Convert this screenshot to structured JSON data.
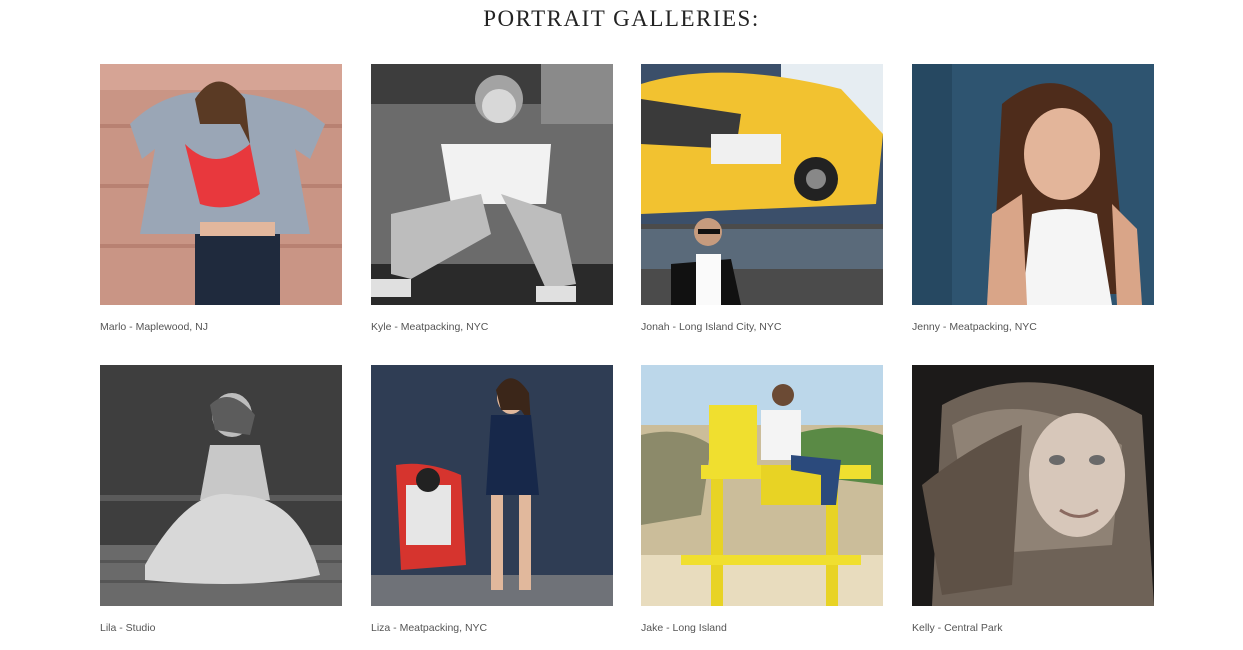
{
  "page": {
    "title": "PORTRAIT GALLERIES:"
  },
  "galleries": [
    {
      "caption": "Marlo - Maplewood, NJ"
    },
    {
      "caption": "Kyle - Meatpacking, NYC"
    },
    {
      "caption": "Jonah - Long Island City, NYC"
    },
    {
      "caption": "Jenny - Meatpacking, NYC"
    },
    {
      "caption": "Lila - Studio"
    },
    {
      "caption": "Liza - Meatpacking, NYC"
    },
    {
      "caption": "Jake - Long Island"
    },
    {
      "caption": "Kelly - Central Park"
    }
  ]
}
